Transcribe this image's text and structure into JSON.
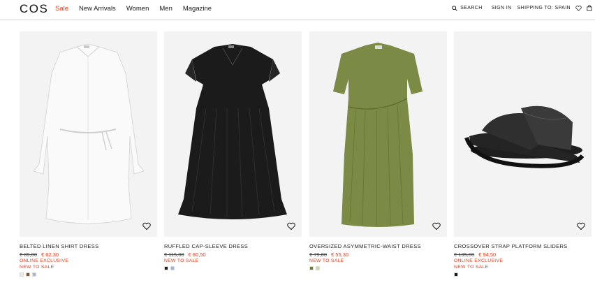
{
  "header": {
    "logo": "COS",
    "nav": [
      {
        "label": "Sale",
        "active": true
      },
      {
        "label": "New Arrivals"
      },
      {
        "label": "Women"
      },
      {
        "label": "Men"
      },
      {
        "label": "Magazine"
      }
    ],
    "search_label": "SEARCH",
    "signin_label": "SIGN IN",
    "shipping_label": "SHIPPING TO: SPAIN",
    "icons": [
      "search-icon",
      "heart-icon",
      "bag-icon"
    ]
  },
  "colors": {
    "sale": "#e03c1d",
    "tile_bg": "#f3f3f3"
  },
  "products": [
    {
      "name": "BELTED LINEN SHIRT DRESS",
      "old_price": "€ 89,00",
      "new_price": "€ 62,30",
      "tags": [
        "ONLINE EXCLUSIVE",
        "NEW TO SALE"
      ],
      "swatches": [
        "#ece9e4",
        "#7b5a2f",
        "#a9b6d6"
      ]
    },
    {
      "name": "RUFFLED CAP-SLEEVE DRESS",
      "old_price": "€ 115,00",
      "new_price": "€ 80,50",
      "tags": [
        "NEW TO SALE"
      ],
      "swatches": [
        "#1a1a1a",
        "#9fb4d9"
      ]
    },
    {
      "name": "OVERSIZED ASYMMETRIC-WAIST DRESS",
      "old_price": "€ 79,00",
      "new_price": "€ 55,30",
      "tags": [
        "NEW TO SALE"
      ],
      "swatches": [
        "#6e7a3c",
        "#d6d2a8"
      ]
    },
    {
      "name": "CROSSOVER STRAP PLATFORM SLIDERS",
      "old_price": "€ 135,00",
      "new_price": "€ 94,50",
      "tags": [
        "ONLINE EXCLUSIVE",
        "NEW TO SALE"
      ],
      "swatches": [
        "#1a1a1a"
      ]
    }
  ]
}
